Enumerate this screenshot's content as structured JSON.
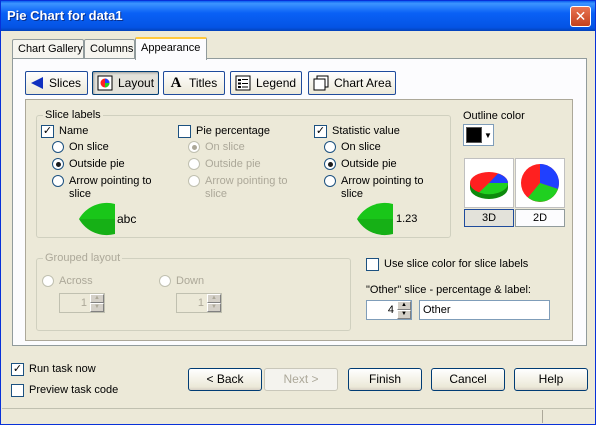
{
  "window": {
    "title": "Pie Chart for data1",
    "close_glyph": "✕"
  },
  "top_tabs": [
    "Chart Gallery",
    "Columns",
    "Appearance"
  ],
  "active_top_tab": "Appearance",
  "sub_tabs": [
    {
      "label": "Slices",
      "icon": "slices-icon"
    },
    {
      "label": "Layout",
      "icon": "layout-icon"
    },
    {
      "label": "Titles",
      "icon": "titles-icon"
    },
    {
      "label": "Legend",
      "icon": "legend-icon"
    },
    {
      "label": "Chart Area",
      "icon": "chart-area-icon"
    }
  ],
  "active_sub_tab": "Layout",
  "slice_labels": {
    "title": "Slice labels",
    "name": {
      "label": "Name",
      "checked": true,
      "options": [
        "On slice",
        "Outside pie",
        "Arrow pointing to slice"
      ],
      "selected": "Outside pie",
      "preview_text": "abc"
    },
    "pie_percentage": {
      "label": "Pie percentage",
      "checked": false,
      "options": [
        "On slice",
        "Outside pie",
        "Arrow pointing to slice"
      ],
      "selected": "On slice"
    },
    "statistic_value": {
      "label": "Statistic value",
      "checked": true,
      "options": [
        "On slice",
        "Outside pie",
        "Arrow pointing to slice"
      ],
      "selected": "Outside pie",
      "preview_text": "1.23"
    }
  },
  "outline_color": {
    "label": "Outline color",
    "value": "#000000"
  },
  "pie_mode": {
    "options": [
      "3D",
      "2D"
    ],
    "selected": "3D"
  },
  "grouped_layout": {
    "title": "Grouped layout",
    "across_label": "Across",
    "across_value": "1",
    "down_label": "Down",
    "down_value": "1"
  },
  "use_slice_color": {
    "label": "Use slice color for slice labels",
    "checked": false
  },
  "other_slice": {
    "label": "\"Other\" slice - percentage & label:",
    "percentage": "4",
    "text": "Other"
  },
  "footer": {
    "run_task_now": {
      "label": "Run task now",
      "checked": true
    },
    "preview_task_code": {
      "label": "Preview task code",
      "checked": false
    },
    "buttons": {
      "back": "< Back",
      "next": "Next >",
      "finish": "Finish",
      "cancel": "Cancel",
      "help": "Help"
    }
  },
  "colors": {
    "accent_green": "#19c619",
    "pie_red": "#ff2020",
    "pie_green": "#20d020",
    "pie_blue": "#2040ff"
  }
}
